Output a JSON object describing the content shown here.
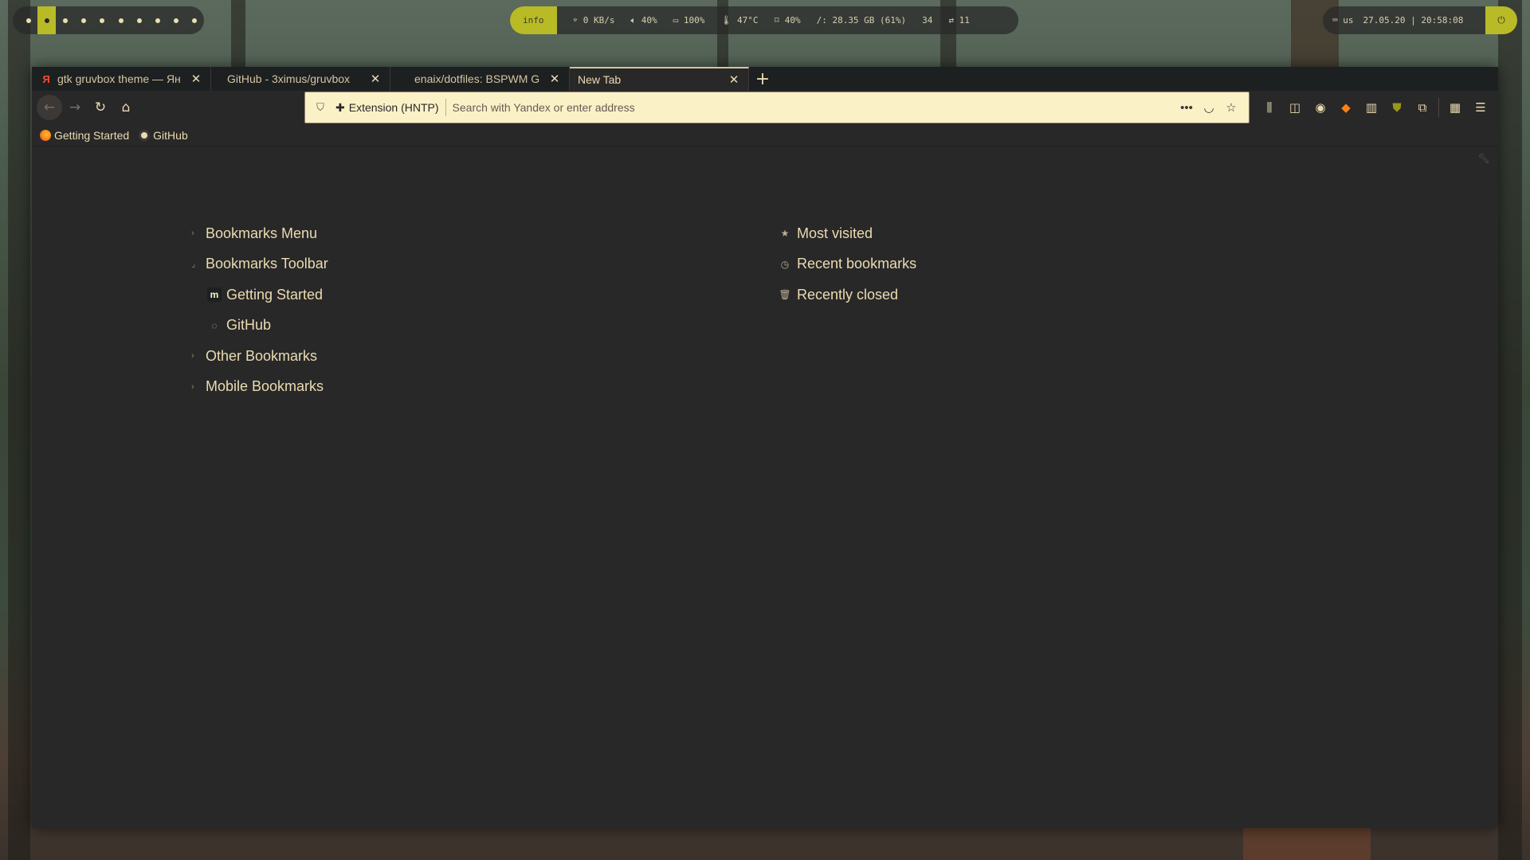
{
  "panel": {
    "workspaces_count": 10,
    "active_workspace_index": 1,
    "info_label": "info",
    "items": [
      "0 KB/s",
      "40%",
      "100%",
      "47°C",
      "40%",
      "/: 28.35 GB (61%)",
      "34",
      "11"
    ],
    "item_icons": [
      "wifi-icon",
      "volume-icon",
      "battery-icon",
      "temperature-icon",
      "cpu-icon",
      "disk-icon",
      "updates-icon",
      "swap-icon"
    ],
    "keyboard_layout": "us",
    "datetime": "27.05.20 | 20:58:08",
    "accent": "#b8bb26"
  },
  "browser": {
    "tabs": [
      {
        "title": "gtk gruvbox theme — Ян",
        "icon": "yandex-icon",
        "active": false
      },
      {
        "title": "GitHub - 3ximus/gruvbox",
        "icon": "none",
        "active": false
      },
      {
        "title": "enaix/dotfiles: BSPWM G",
        "icon": "none",
        "active": false
      },
      {
        "title": "New Tab",
        "icon": "none",
        "active": true
      }
    ],
    "urlbar": {
      "extension_label": "Extension (HNTP)",
      "placeholder": "Search with Yandex or enter address"
    },
    "bookmarks_toolbar": [
      {
        "label": "Getting Started",
        "icon": "firefox-icon"
      },
      {
        "label": "GitHub",
        "icon": "github-icon"
      }
    ]
  },
  "newtab": {
    "left": [
      {
        "label": "Bookmarks Menu",
        "expanded": false,
        "level": 0
      },
      {
        "label": "Bookmarks Toolbar",
        "expanded": true,
        "level": 0
      },
      {
        "label": "Getting Started",
        "level": 1,
        "icon": "mozilla-icon"
      },
      {
        "label": "GitHub",
        "level": 1,
        "icon": "github-icon"
      },
      {
        "label": "Other Bookmarks",
        "expanded": false,
        "level": 0
      },
      {
        "label": "Mobile Bookmarks",
        "expanded": false,
        "level": 0
      }
    ],
    "right": [
      {
        "label": "Most visited",
        "icon": "star-icon"
      },
      {
        "label": "Recent bookmarks",
        "icon": "clock-icon"
      },
      {
        "label": "Recently closed",
        "icon": "trash-icon"
      }
    ]
  }
}
